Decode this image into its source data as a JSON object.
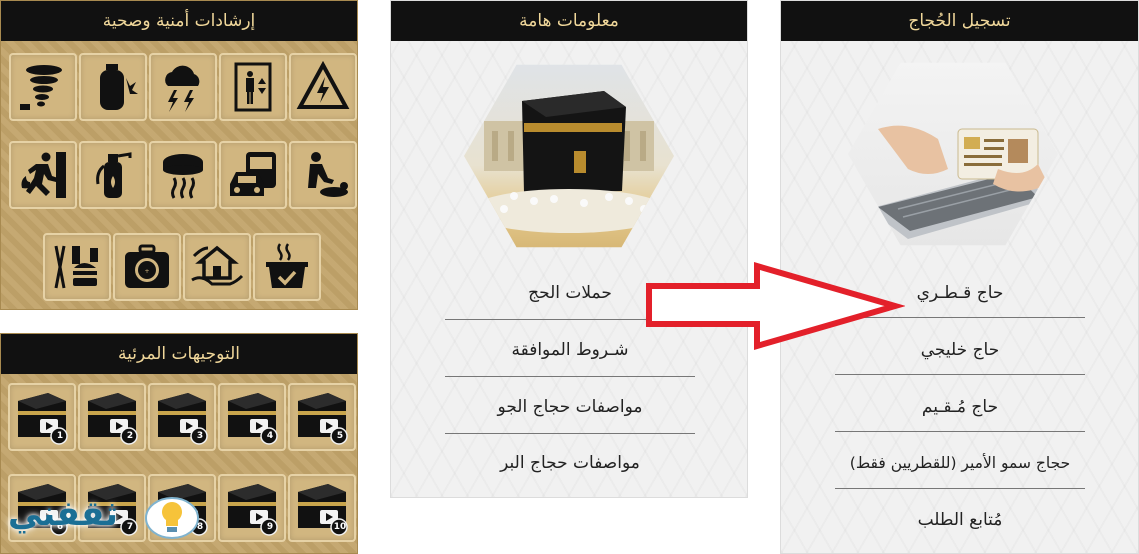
{
  "safety_panel": {
    "title": "إرشادات أمنية وصحية",
    "icons": [
      "warning-high-voltage-icon",
      "elevator-icon",
      "lightning-storm-icon",
      "gas-cylinder-icon",
      "tornado-icon",
      "cpr-icon",
      "bus-car-icon",
      "smoke-detector-icon",
      "fire-extinguisher-icon",
      "fire-exit-icon",
      "cooking-pot-icon",
      "house-hands-icon",
      "first-aid-kit-icon",
      "food-comb-icon"
    ]
  },
  "visual_panel": {
    "title": "التوجيهات المرئية",
    "video_numbers": [
      "5",
      "4",
      "3",
      "2",
      "1",
      "10",
      "9",
      "8",
      "7",
      "6"
    ]
  },
  "info_panel": {
    "title": "معلومات هامة",
    "items": [
      "حملات الحج",
      "شـروط الموافقة",
      "مواصفات حجاج الجو",
      "مواصفات حجاج البر"
    ]
  },
  "registration_panel": {
    "title": "تسجيل الحُجاج",
    "items": [
      "حاج قـطـري",
      "حاج خليجي",
      "حاج مُـقـيم",
      "حجاج سمو الأمير (للقطريين فقط)",
      "مُتابع الطلب"
    ]
  },
  "watermark": {
    "text": "ثقفني"
  },
  "colors": {
    "arrow": "#e3202a",
    "header_bg": "#111111",
    "header_text": "#f0d79a",
    "gold": "#c2a46a"
  }
}
